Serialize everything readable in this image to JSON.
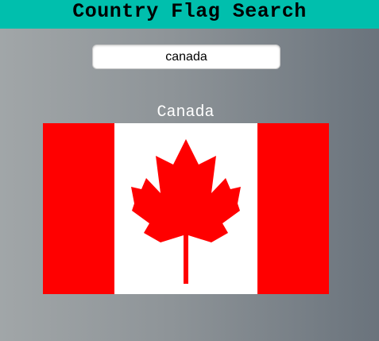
{
  "header": {
    "title": "Country Flag Search",
    "background_color": "#00bfad"
  },
  "search": {
    "value": "canada"
  },
  "result": {
    "country_name": "Canada",
    "flag": {
      "icon": "canada-flag",
      "band_color": "#ff0000",
      "center_color": "#ffffff",
      "emblem": "maple-leaf-icon"
    }
  }
}
